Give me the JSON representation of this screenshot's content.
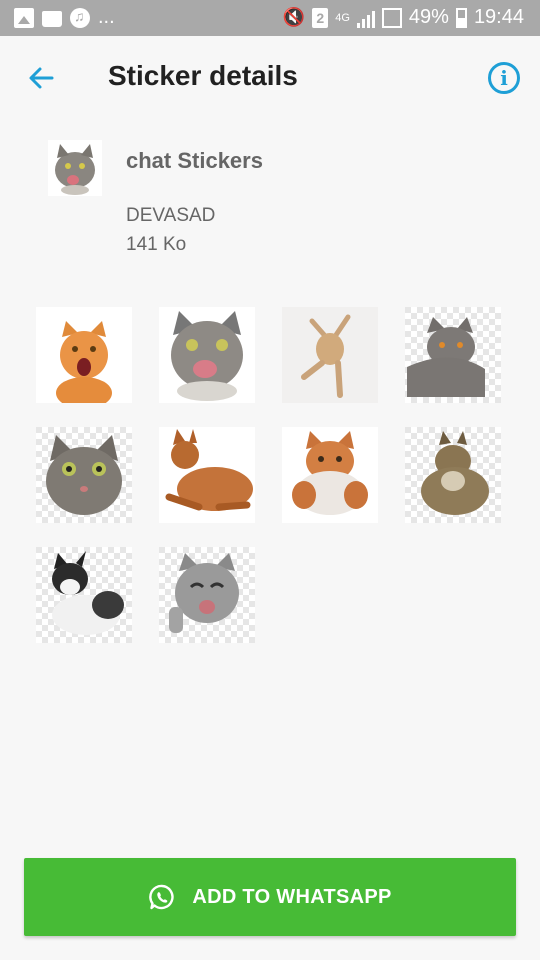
{
  "status_bar": {
    "dots": "...",
    "sim_badge": "2",
    "network": "4G",
    "battery": "49%",
    "time": "19:44"
  },
  "app_bar": {
    "title": "Sticker details",
    "back_icon": "arrow-left-icon",
    "info_icon": "info-icon",
    "accent_color": "#1e9fd6"
  },
  "pack": {
    "name": "chat Stickers",
    "publisher": "DEVASAD",
    "size": "141 Ko"
  },
  "stickers": [
    {
      "name": "orange-cat-sticker"
    },
    {
      "name": "grey-cat-licking-sticker"
    },
    {
      "name": "jumping-cat-sticker"
    },
    {
      "name": "british-shorthair-sticker"
    },
    {
      "name": "tabby-face-sticker"
    },
    {
      "name": "lying-ginger-cat-sticker"
    },
    {
      "name": "fluffy-kitten-sticker"
    },
    {
      "name": "maine-coon-sticker"
    },
    {
      "name": "black-white-cat-sticker"
    },
    {
      "name": "grey-kitten-sticker"
    }
  ],
  "add_button": {
    "label": "ADD TO WHATSAPP",
    "icon": "whatsapp-icon",
    "color": "#47bb36"
  }
}
